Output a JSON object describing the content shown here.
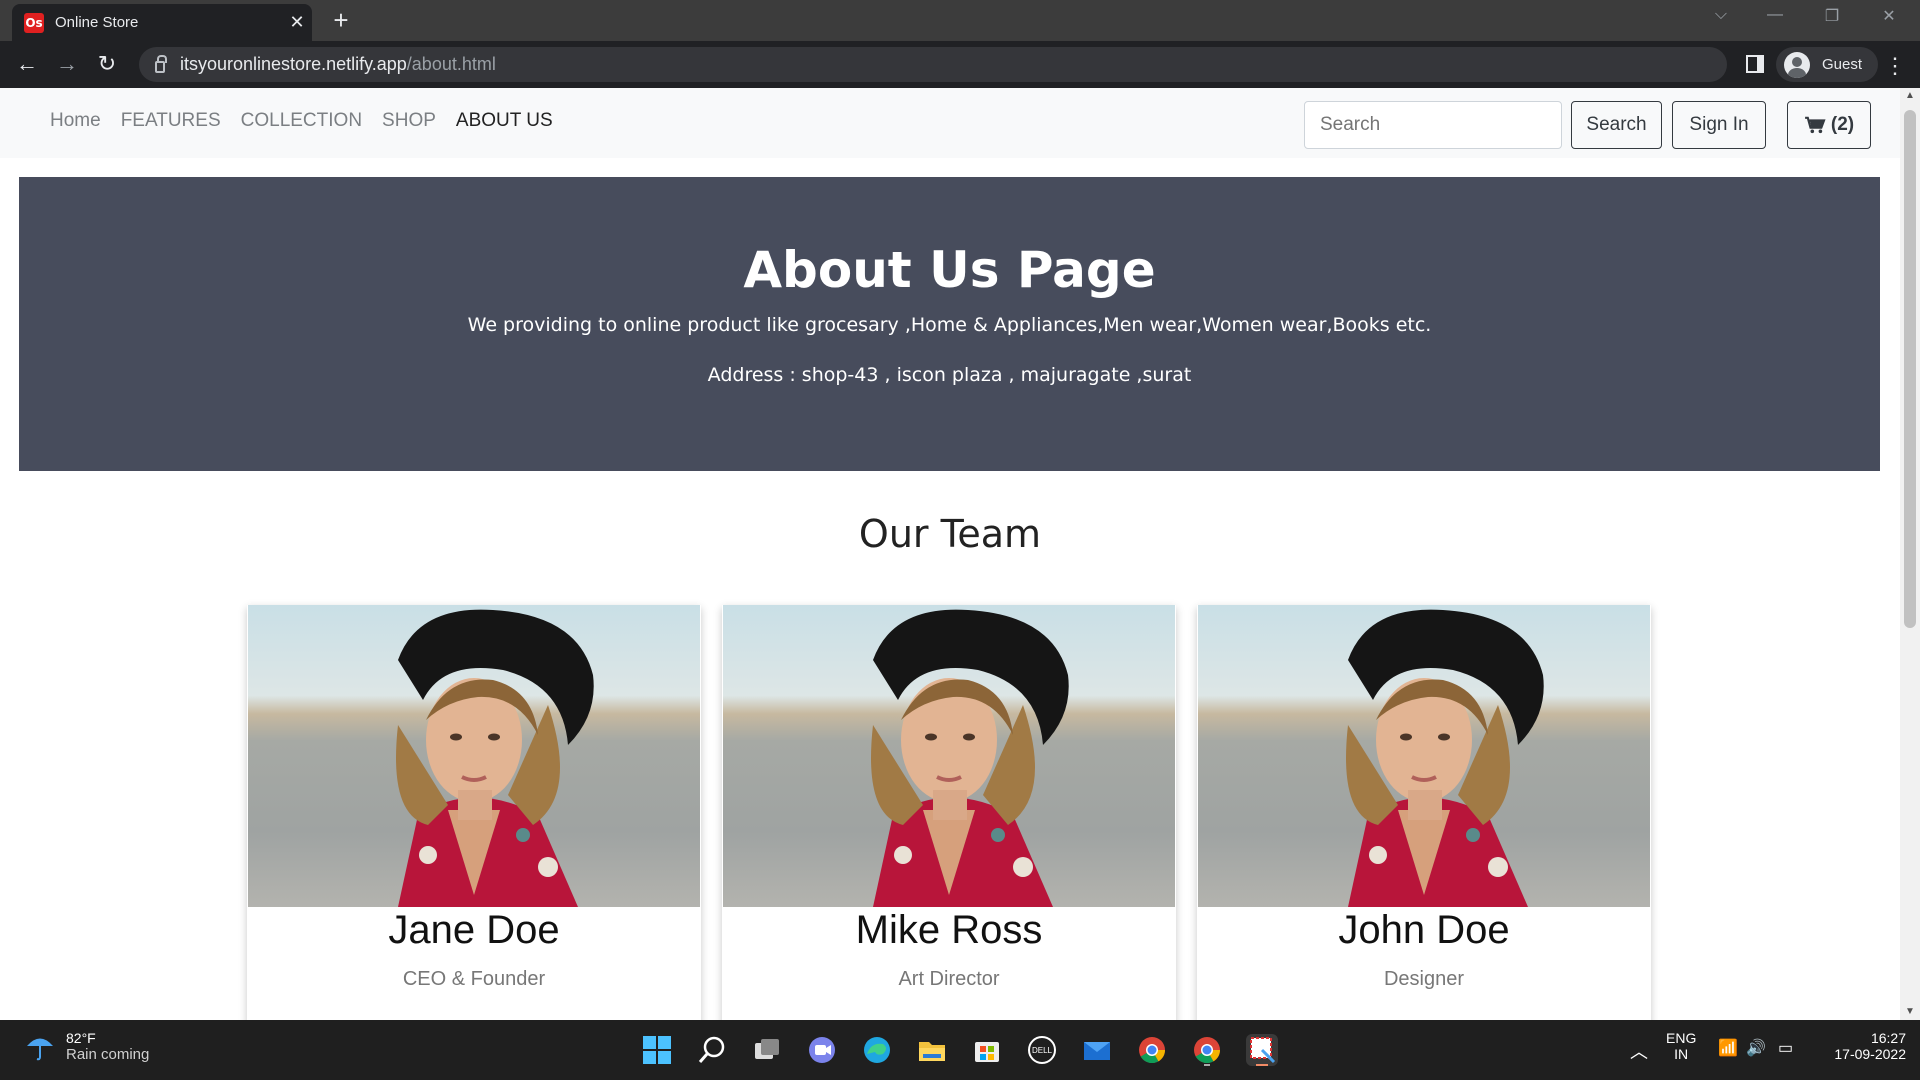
{
  "browser": {
    "tab_title": "Online Store",
    "favicon_text": "Os",
    "url_host": "itsyouronlinestore.netlify.app",
    "url_path": "/about.html",
    "profile_label": "Guest"
  },
  "nav": {
    "links": [
      "Home",
      "FEATURES",
      "COLLECTION",
      "SHOP",
      "ABOUT US"
    ],
    "active": "ABOUT US",
    "search_placeholder": "Search",
    "search_button": "Search",
    "signin_button": "Sign In",
    "cart_count": "(2)"
  },
  "hero": {
    "title": "About Us Page",
    "description": "We providing to online product like grocesary ,Home & Appliances,Men wear,Women wear,Books etc.",
    "address": "Address : shop-43 , iscon plaza , majuragate ,surat",
    "background": "#474c5c"
  },
  "team": {
    "title": "Our Team",
    "members": [
      {
        "name": "Jane Doe",
        "role": "CEO & Founder"
      },
      {
        "name": "Mike Ross",
        "role": "Art Director"
      },
      {
        "name": "John Doe",
        "role": "Designer"
      }
    ]
  },
  "taskbar": {
    "temperature": "82°F",
    "weather": "Rain coming",
    "lang_top": "ENG",
    "lang_bottom": "IN",
    "time": "16:27",
    "date": "17-09-2022"
  }
}
